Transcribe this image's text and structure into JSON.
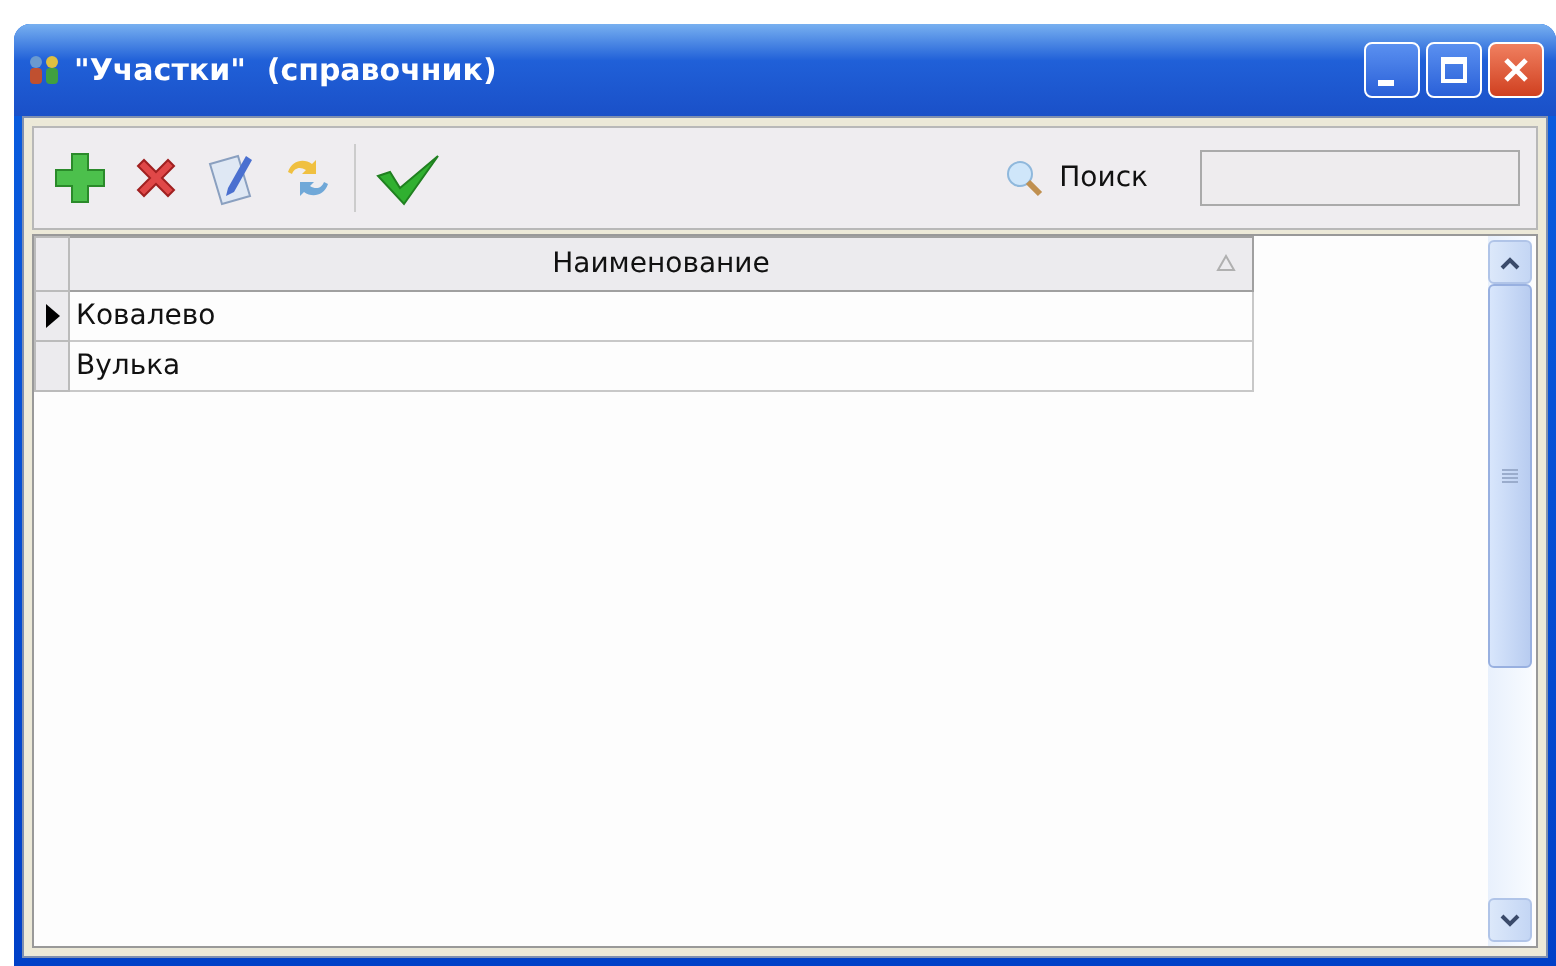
{
  "window": {
    "title": "\"Участки\"  (справочник)"
  },
  "toolbar": {
    "search_label": "Поиск"
  },
  "table": {
    "columns": [
      {
        "label": "Наименование",
        "sorted": true
      }
    ],
    "rows": [
      {
        "name": "Ковалево",
        "selected": true
      },
      {
        "name": "Вулька",
        "selected": false
      }
    ]
  }
}
